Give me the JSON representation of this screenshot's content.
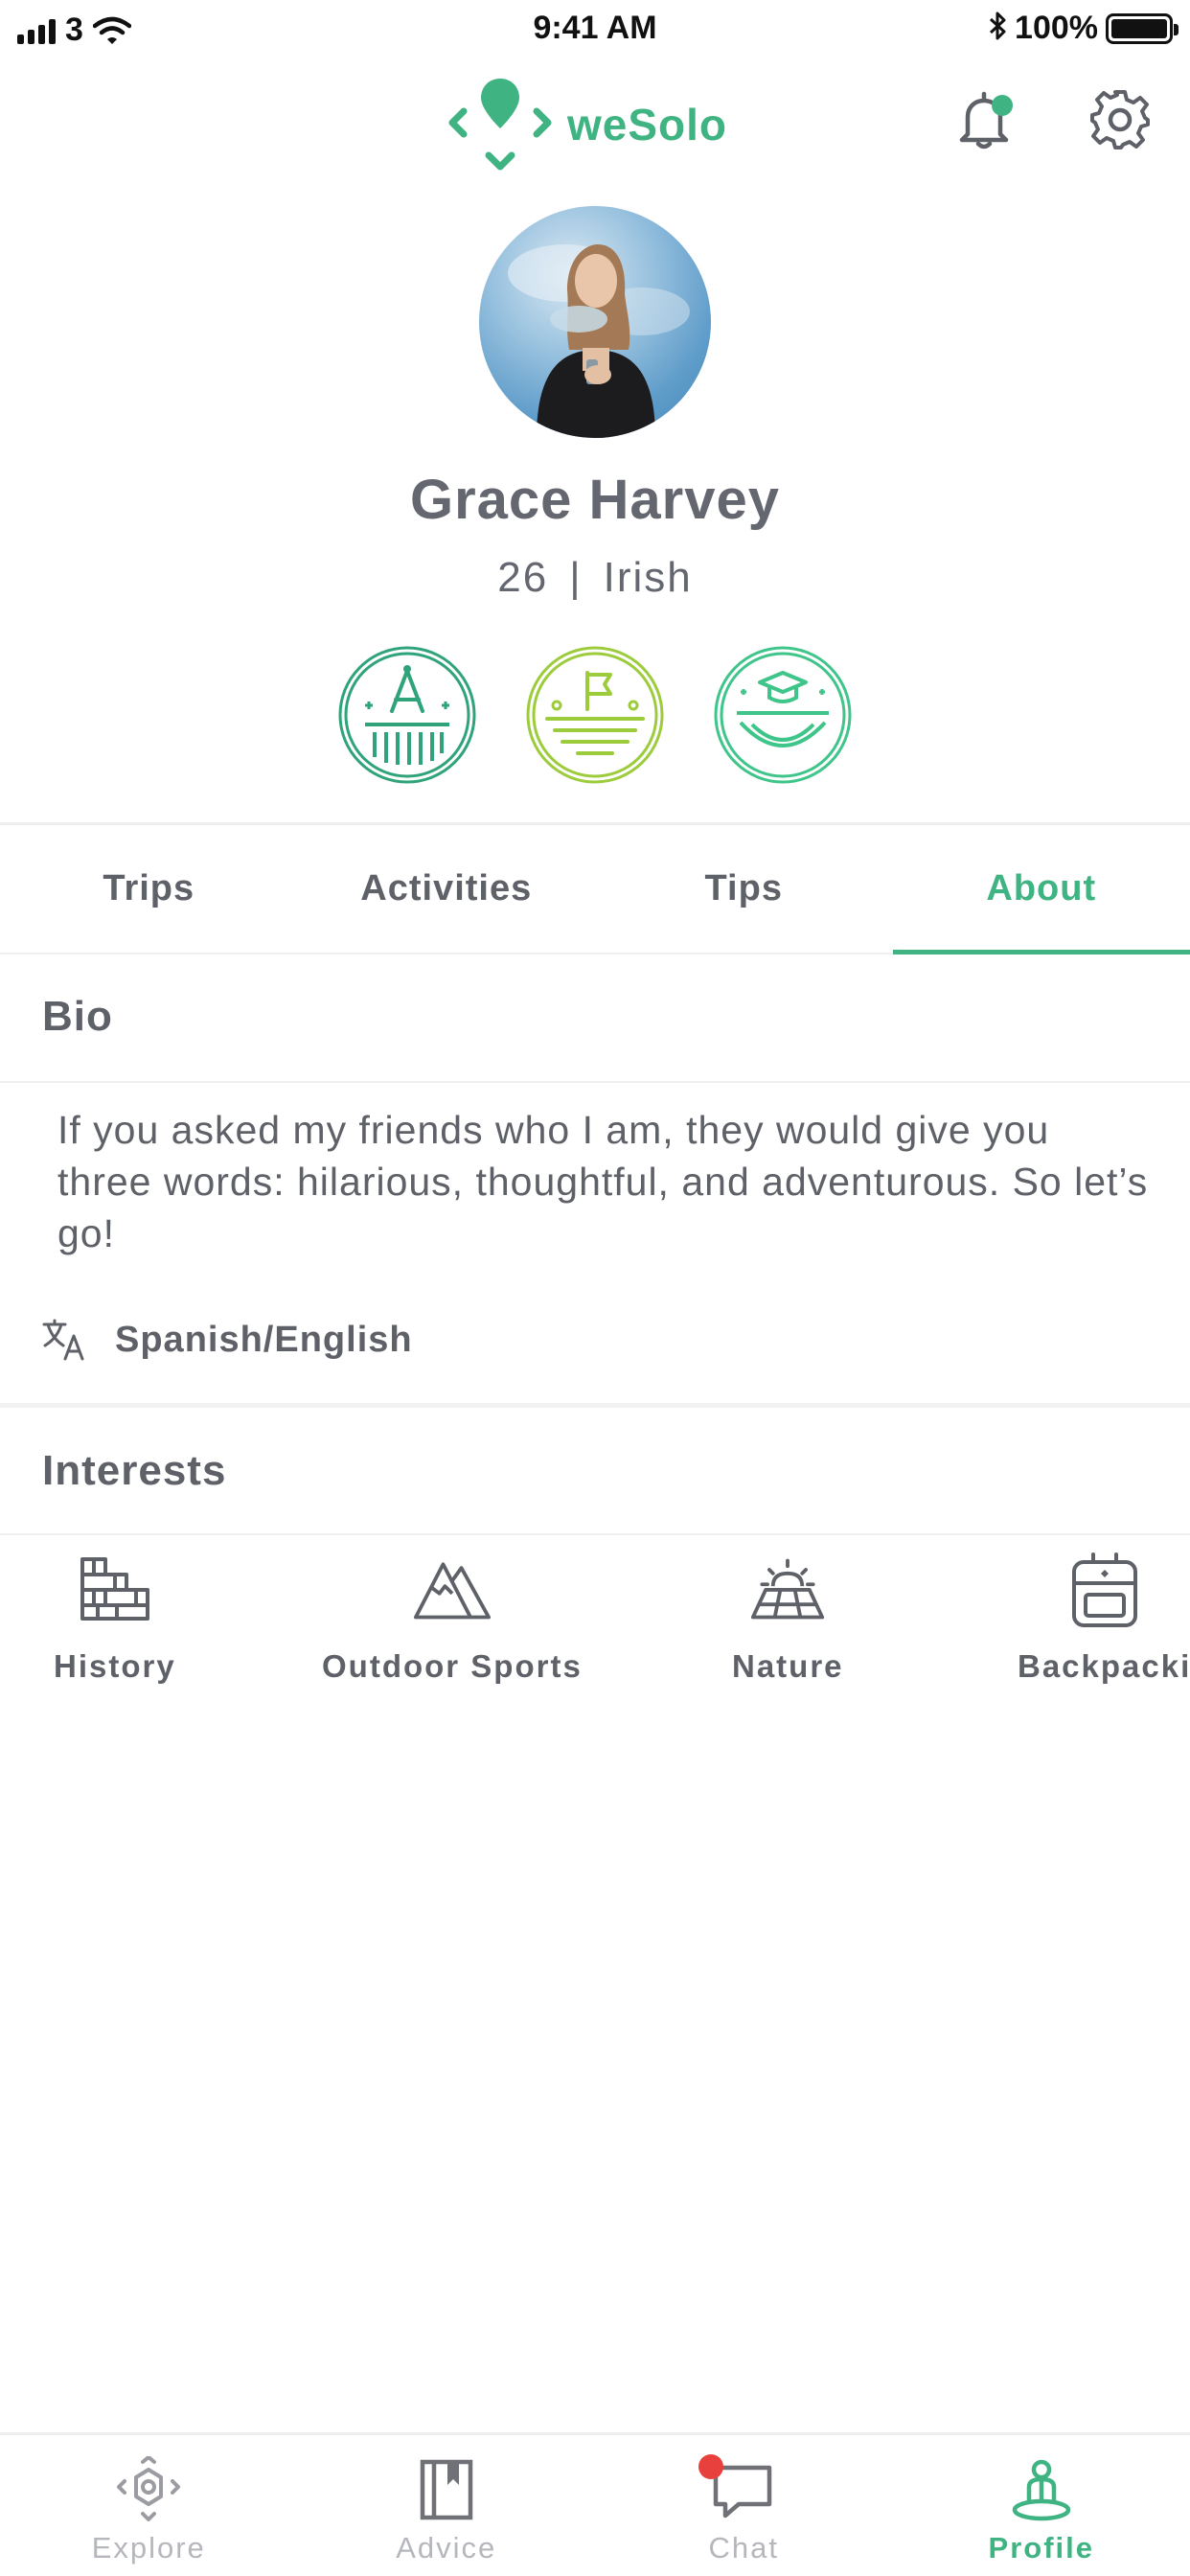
{
  "status_bar": {
    "carrier": "3",
    "time": "9:41 AM",
    "battery": "100%"
  },
  "header": {
    "brand": "weSolo",
    "notification_badge_color": "#3fb382"
  },
  "profile": {
    "name": "Grace Harvey",
    "age": "26",
    "separator": "|",
    "nationality": "Irish",
    "badges": [
      "compass-badge",
      "flag-badge",
      "graduation-badge"
    ]
  },
  "tabs": [
    {
      "label": "Trips",
      "active": false
    },
    {
      "label": "Activities",
      "active": false
    },
    {
      "label": "Tips",
      "active": false
    },
    {
      "label": "About",
      "active": true
    }
  ],
  "bio": {
    "title": "Bio",
    "text": "If you asked my friends who I am, they would give you three words: hilarious, thoughtful, and adventurous. So let’s go!",
    "languages": "Spanish/English"
  },
  "interests": {
    "title": "Interests",
    "items": [
      {
        "label": "History",
        "icon": "wall-icon"
      },
      {
        "label": "Outdoor Sports",
        "icon": "mountain-icon"
      },
      {
        "label": "Nature",
        "icon": "sunrise-icon"
      },
      {
        "label": "Backpacki",
        "icon": "backpack-icon"
      }
    ]
  },
  "bottom_nav": [
    {
      "label": "Explore",
      "icon": "explore-icon",
      "active": false
    },
    {
      "label": "Advice",
      "icon": "book-icon",
      "active": false
    },
    {
      "label": "Chat",
      "icon": "chat-icon",
      "active": false,
      "notification": true
    },
    {
      "label": "Profile",
      "icon": "profile-icon",
      "active": true
    }
  ],
  "colors": {
    "accent": "#3fb382",
    "text": "#5f6168",
    "inactive": "#b5b7bc",
    "alert": "#e8413d"
  }
}
